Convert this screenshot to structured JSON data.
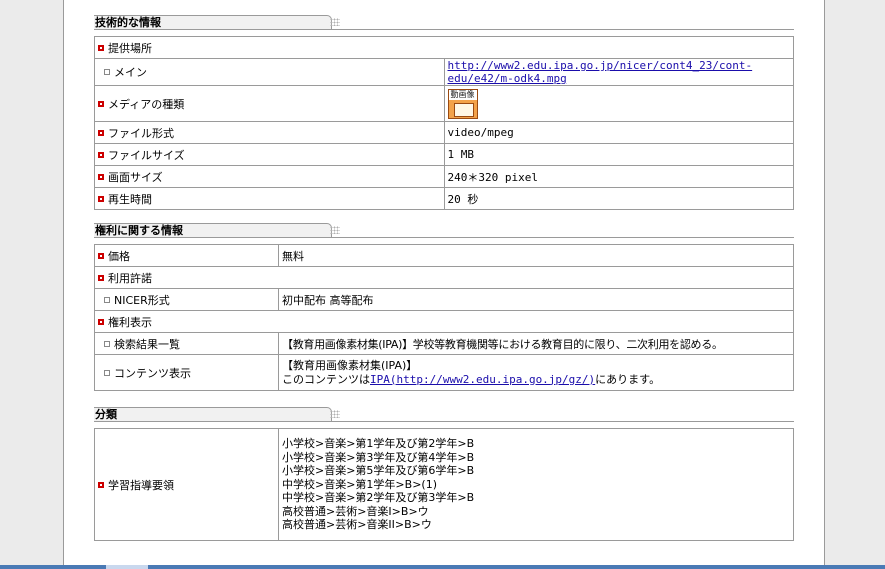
{
  "tech": {
    "title": "技術的な情報",
    "location_label": "提供場所",
    "main_label": "メイン",
    "main_url": "http://www2.edu.ipa.go.jp/nicer/cont4_23/cont-edu/e42/m-odk4.mpg",
    "media_type_label": "メディアの種類",
    "media_icon_text": "動画像",
    "file_format_label": "ファイル形式",
    "file_format_value": "video/mpeg",
    "file_size_label": "ファイルサイズ",
    "file_size_value": "1 MB",
    "screen_size_label": "画面サイズ",
    "screen_size_value": "240＊320 pixel",
    "duration_label": "再生時間",
    "duration_value": "20 秒"
  },
  "rights": {
    "title": "権利に関する情報",
    "price_label": "価格",
    "price_value": "無料",
    "license_label": "利用許諾",
    "nicer_label": "NICER形式",
    "nicer_value": "初中配布 高等配布",
    "rights_display_label": "権利表示",
    "search_result_label": "検索結果一覧",
    "search_result_value": "【教育用画像素材集(IPA)】学校等教育機関等における教育目的に限り、二次利用を認める。",
    "content_display_label": "コンテンツ表示",
    "content_line1": "【教育用画像素材集(IPA)】",
    "content_line2_prefix": "このコンテンツは",
    "content_link": "IPA(http://www2.edu.ipa.go.jp/gz/)",
    "content_line2_suffix": "にあります。"
  },
  "classification": {
    "title": "分類",
    "guideline_label": "学習指導要領",
    "items": [
      "小学校>音楽>第1学年及び第2学年>B",
      "小学校>音楽>第3学年及び第4学年>B",
      "小学校>音楽>第5学年及び第6学年>B",
      "中学校>音楽>第1学年>B>(1)",
      "中学校>音楽>第2学年及び第3学年>B",
      "高校普通>芸術>音楽I>B>ウ",
      "高校普通>芸術>音楽II>B>ウ"
    ]
  }
}
